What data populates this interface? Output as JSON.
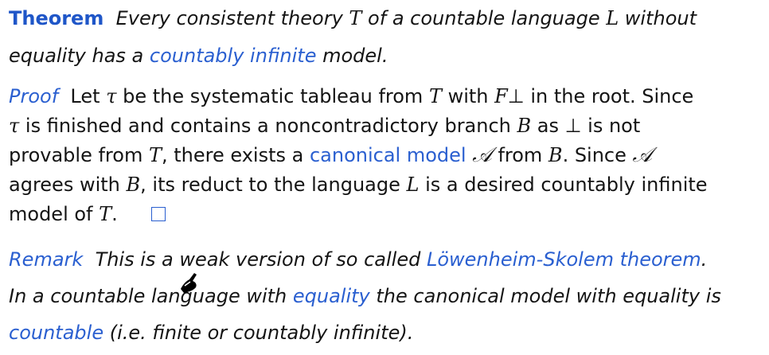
{
  "theorem": {
    "label": "Theorem",
    "line1": {
      "t1": "Every consistent theory ",
      "m1": "T",
      "t2": " of a countable language ",
      "m2": "L",
      "t3": " without"
    },
    "line2": {
      "t1": "equality has a ",
      "link": "countably infinite",
      "t2": " model."
    }
  },
  "proof": {
    "label": "Proof",
    "line1": {
      "t1": "Let ",
      "m1": "τ",
      "t2": " be the systematic tableau from ",
      "m2": "T",
      "t3": " with ",
      "m3": "F",
      "m3b": "⊥",
      "t4": " in the root. Since"
    },
    "line2": {
      "m1": "τ",
      "t1": " is finished and contains a noncontradictory branch ",
      "m2": "B",
      "t2": " as ",
      "m3": "⊥",
      "t3": " is not"
    },
    "line3": {
      "t1": "provable from ",
      "m1": "T",
      "t2": ", there exists a ",
      "link": "canonical model",
      "t3": " ",
      "m2": "𝒜",
      "t4": " from ",
      "m3": "B",
      "t5": ". Since ",
      "m4": "𝒜"
    },
    "line4": {
      "t1": "agrees with ",
      "m1": "B",
      "t2": ", its reduct to the language ",
      "m2": "L",
      "t3": " is a desired countably infinite"
    },
    "line5": {
      "t1": "model of ",
      "m1": "T",
      "t2": "."
    }
  },
  "remark": {
    "label": "Remark",
    "line1": {
      "t1": "This is a weak version of so called ",
      "link": "Löwenheim-Skolem theorem",
      "t2": "."
    },
    "line2": {
      "t1": "In a countable language with ",
      "link": "equality",
      "t2": " the canonical model with equality is"
    },
    "line3": {
      "link": "countable",
      "t1": " (i.e. finite or countably infinite)."
    }
  },
  "icons": {
    "qed": "qed-box-icon",
    "pointer": "hand-pointer-icon"
  },
  "colors": {
    "text": "#141414",
    "accent_blue": "#2a5fd0",
    "heading_blue": "#1f56c8",
    "background": "#ffffff"
  }
}
